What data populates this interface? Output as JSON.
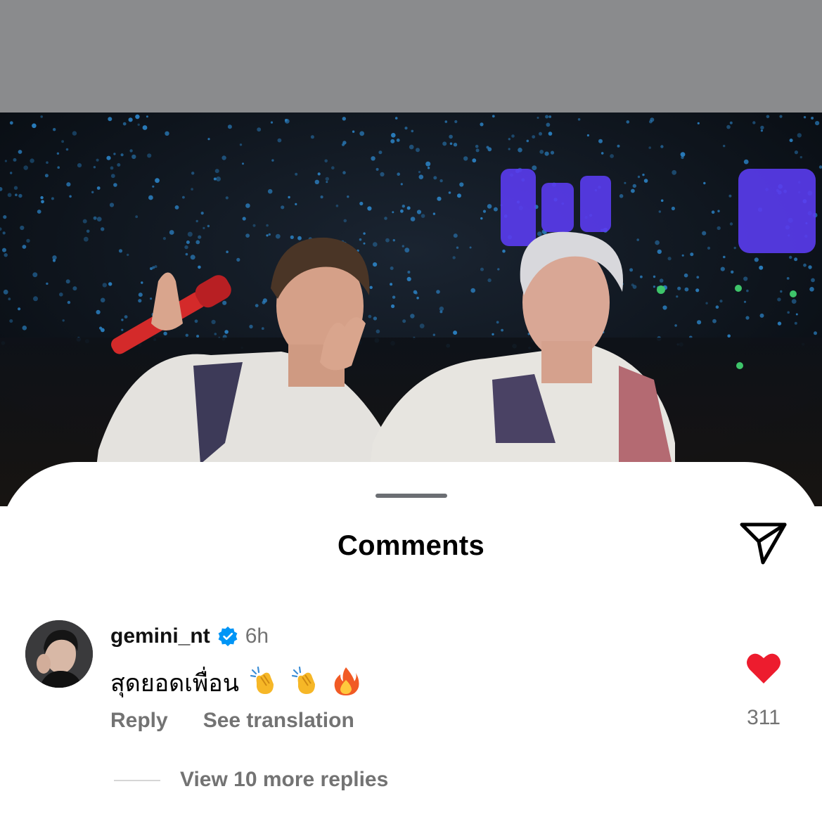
{
  "sheet": {
    "title": "Comments"
  },
  "comment": {
    "username": "gemini_nt",
    "timestamp": "6h",
    "text": "สุดยอดเพื่อน",
    "emojis": [
      "clapping-hands",
      "clapping-hands",
      "fire"
    ],
    "reply_label": "Reply",
    "translate_label": "See translation",
    "like_count": "311",
    "liked": true
  },
  "replies": {
    "view_label": "View 10 more replies"
  },
  "colors": {
    "top_bar": "#8a8b8d",
    "heart": "#ed1c2e",
    "verified": "#0095f6",
    "muted_text": "#737373"
  }
}
